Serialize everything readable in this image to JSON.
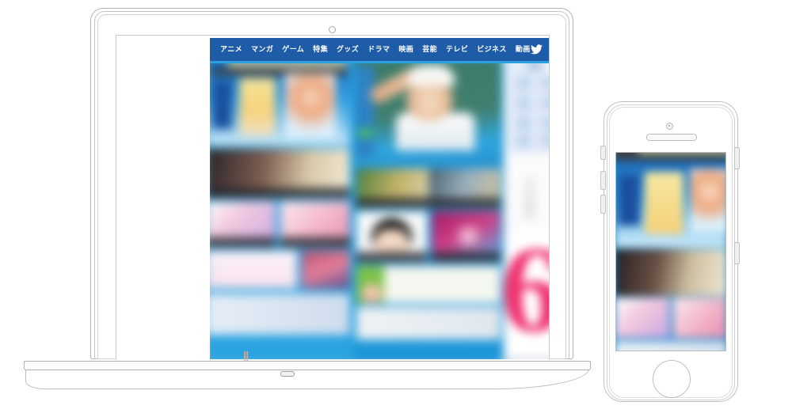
{
  "scene": {
    "description": "Responsive website mockup shown on a laptop and a smartphone",
    "devices": [
      "laptop",
      "smartphone"
    ]
  },
  "colors": {
    "nav_bar_blue": "#1f5ca8",
    "nav_text": "#ffffff",
    "site_accent_blue": "#2ea6e4",
    "device_outline": "#c0c0c0",
    "highlight_pink": "#f0316e",
    "sidebar_panel": "#e4ecf8"
  },
  "website": {
    "nav": {
      "items": [
        {
          "label": "アニメ"
        },
        {
          "label": "マンガ"
        },
        {
          "label": "ゲーム"
        },
        {
          "label": "特集"
        },
        {
          "label": "グッズ"
        },
        {
          "label": "ドラマ"
        },
        {
          "label": "映画"
        },
        {
          "label": "芸能"
        },
        {
          "label": "テレビ"
        },
        {
          "label": "ビジネス"
        },
        {
          "label": "動画"
        }
      ],
      "icons": [
        {
          "name": "twitter-icon"
        },
        {
          "name": "search-icon"
        }
      ]
    },
    "content": {
      "sidebar_number": "6"
    }
  },
  "laptop": {
    "name": "laptop-device",
    "camera": "camera-dot",
    "base_notch": "base-notch"
  },
  "phone": {
    "name": "smartphone-device",
    "camera": "front-camera",
    "speaker": "earpiece-speaker",
    "home_button": "home-button",
    "buttons": [
      "silent-switch",
      "volume-up-button",
      "volume-down-button"
    ]
  }
}
